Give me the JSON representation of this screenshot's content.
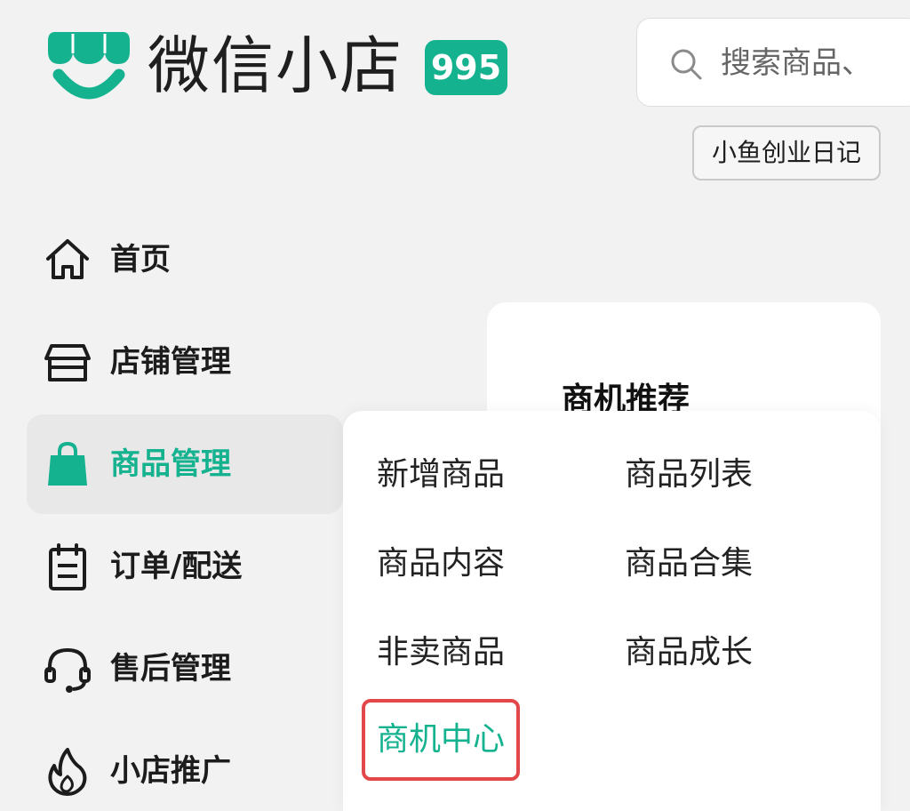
{
  "brand": {
    "name": "微信小店",
    "badge": "995",
    "accent_color": "#14b28f",
    "logo_icon": "shop-awning-smile-icon"
  },
  "search": {
    "placeholder": "搜索商品、",
    "icon": "search-icon"
  },
  "shop": {
    "name": "小鱼创业日记"
  },
  "sidebar": {
    "items": [
      {
        "label": "首页",
        "icon": "home-icon",
        "active": false
      },
      {
        "label": "店铺管理",
        "icon": "storefront-icon",
        "active": false
      },
      {
        "label": "商品管理",
        "icon": "shopping-bag-icon",
        "active": true
      },
      {
        "label": "订单/配送",
        "icon": "clipboard-icon",
        "active": false
      },
      {
        "label": "售后管理",
        "icon": "headset-icon",
        "active": false
      },
      {
        "label": "小店推广",
        "icon": "flame-icon",
        "active": false
      }
    ]
  },
  "opportunity_card": {
    "title": "商机推荐"
  },
  "submenu": {
    "items": [
      {
        "label": "新增商品"
      },
      {
        "label": "商品列表"
      },
      {
        "label": "商品内容"
      },
      {
        "label": "商品合集"
      },
      {
        "label": "非卖商品"
      },
      {
        "label": "商品成长"
      },
      {
        "label": "商机中心",
        "highlighted": true
      }
    ],
    "highlight_color": "#e2484a"
  }
}
